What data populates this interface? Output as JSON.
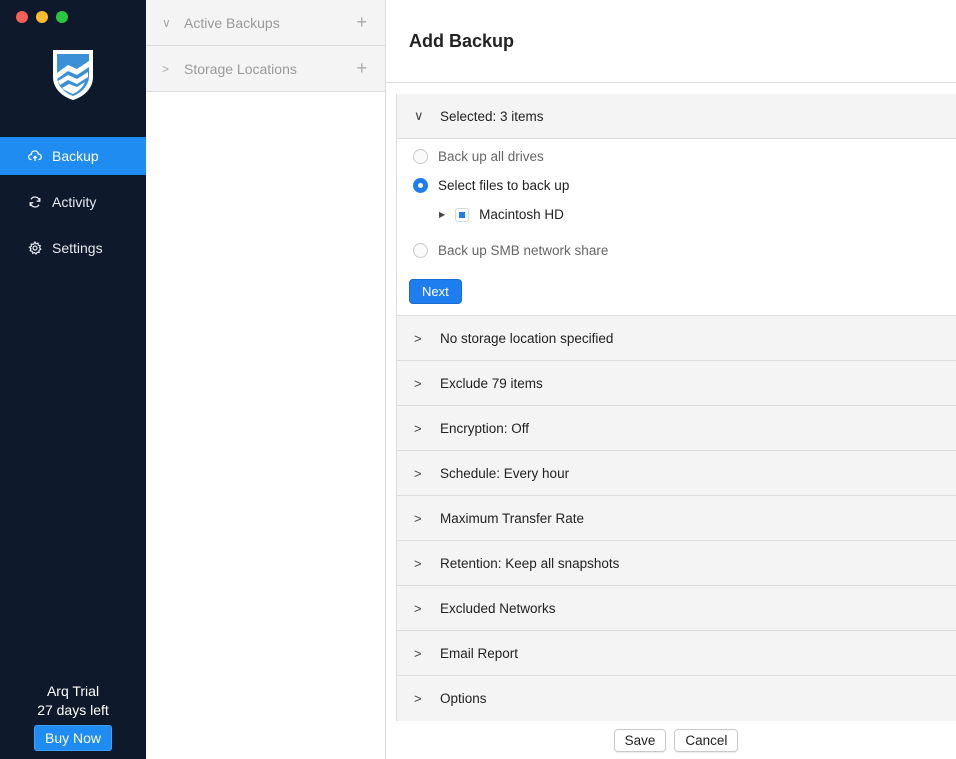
{
  "sidebar": {
    "nav": [
      {
        "label": "Backup",
        "icon": "cloud-upload-icon",
        "active": true
      },
      {
        "label": "Activity",
        "icon": "refresh-icon",
        "active": false
      },
      {
        "label": "Settings",
        "icon": "gear-icon",
        "active": false
      }
    ],
    "trial_title": "Arq Trial",
    "trial_days": "27 days left",
    "buy_label": "Buy Now"
  },
  "middle": {
    "rows": [
      {
        "label": "Active Backups",
        "chevron": "∨"
      },
      {
        "label": "Storage Locations",
        "chevron": ">"
      }
    ]
  },
  "main": {
    "title": "Add Backup",
    "selected_header": "Selected: 3 items",
    "options": {
      "all_drives": "Back up all drives",
      "select_files": "Select files to back up",
      "tree_item": "Macintosh HD",
      "smb": "Back up SMB network share"
    },
    "next_label": "Next",
    "sections": [
      "No storage location specified",
      "Exclude 79 items",
      "Encryption: Off",
      "Schedule: Every hour",
      "Maximum Transfer Rate",
      "Retention: Keep all snapshots",
      "Excluded Networks",
      "Email Report",
      "Options"
    ],
    "save_label": "Save",
    "cancel_label": "Cancel"
  },
  "colors": {
    "sidebar_bg": "#0e1a2b",
    "accent": "#1e8cf0"
  }
}
